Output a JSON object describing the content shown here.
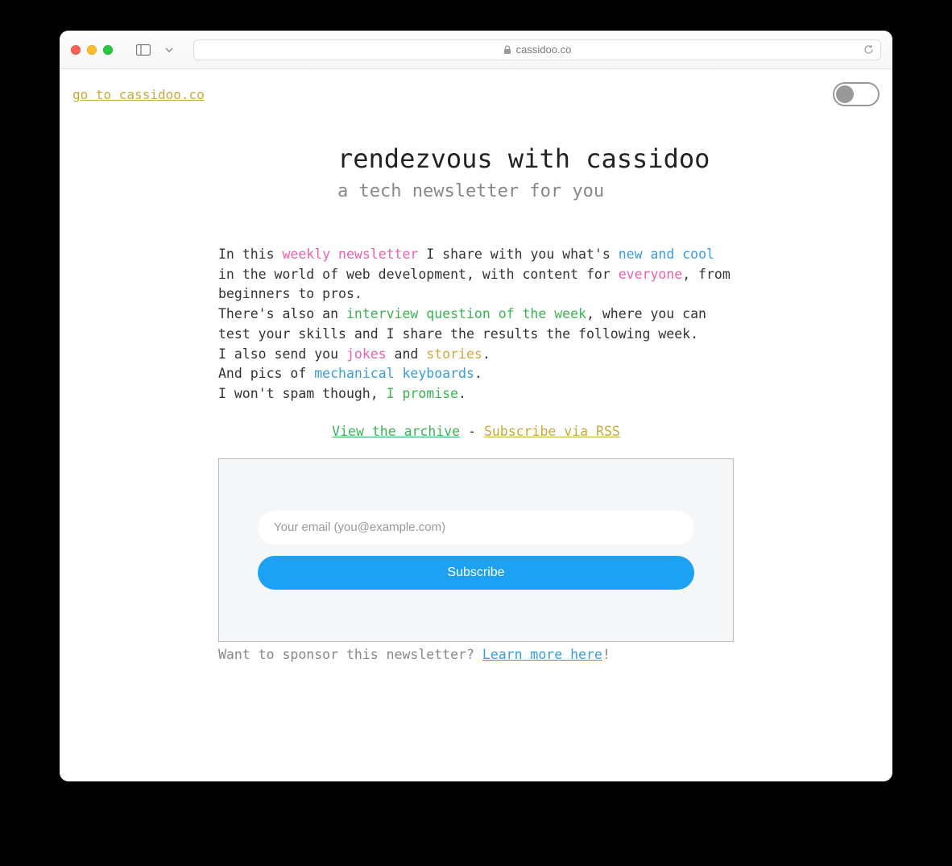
{
  "browser": {
    "url_host": "cassidoo.co"
  },
  "nav": {
    "home_link": "go to cassidoo.co"
  },
  "header": {
    "title": "rendezvous with cassidoo",
    "subtitle": "a tech newsletter for you"
  },
  "description": {
    "line1_a": "In this ",
    "line1_hl1": "weekly newsletter",
    "line1_b": " I share with you what's ",
    "line1_hl2": "new and cool",
    "line1_c": " in the world of web development, with content for ",
    "line1_hl3": "everyone",
    "line1_d": ", from beginners to pros.",
    "line2_a": "There's also an ",
    "line2_hl1": "interview question of the week",
    "line2_b": ", where you can test your skills and I share the results the following week.",
    "line3_a": "I also send you ",
    "line3_hl1": "jokes",
    "line3_b": " and ",
    "line3_hl2": "stories",
    "line3_c": ".",
    "line4_a": "And pics of ",
    "line4_hl1": "mechanical keyboards",
    "line4_b": ".",
    "line5_a": "I won't spam though, ",
    "line5_hl1": "I promise",
    "line5_b": "."
  },
  "links": {
    "archive": "View the archive",
    "separator": " - ",
    "rss": "Subscribe via RSS"
  },
  "subscribe": {
    "email_placeholder": "Your email (you@example.com)",
    "button_label": "Subscribe"
  },
  "sponsor": {
    "prefix": "Want to sponsor this newsletter? ",
    "link": "Learn more here",
    "suffix": "!"
  }
}
